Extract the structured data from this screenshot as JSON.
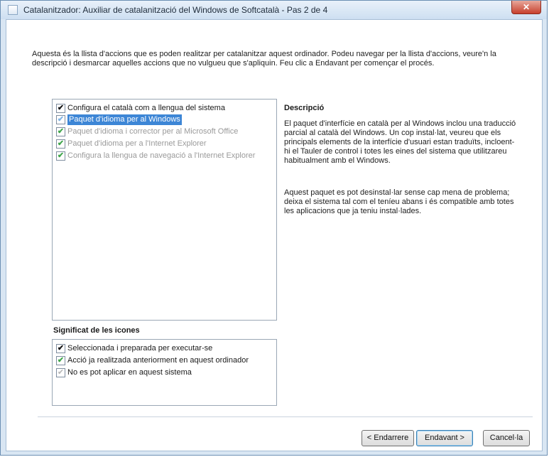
{
  "window": {
    "title": "Catalanitzador: Auxiliar de catalanització del Windows de Softcatalà - Pas 2 de 4",
    "close_glyph": "✕"
  },
  "intro_text": "Aquesta és la llista d'accions que es poden realitzar per catalanitzar aquest ordinador. Podeu navegar per la llista d'accions, veure'n la descripció i desmarcar aquelles accions que no vulgueu que s'apliquin. Feu clic a Endavant per començar el procés.",
  "actions": [
    {
      "label": "Configura el català com a llengua del sistema",
      "check": "✔",
      "state": "selected-black"
    },
    {
      "label": "Paquet d'idioma per al Windows",
      "check": "✔",
      "state": "highlighted"
    },
    {
      "label": "Paquet d'idioma i corrector per al Microsoft Office",
      "check": "✔",
      "state": "done-green"
    },
    {
      "label": "Paquet d'idioma per a l'Internet Explorer",
      "check": "✔",
      "state": "done-green"
    },
    {
      "label": "Configura la llengua de navegació a l'Internet Explorer",
      "check": "✔",
      "state": "done-green"
    }
  ],
  "legend": {
    "title": "Significat de les icones",
    "items": [
      {
        "label": "Seleccionada i preparada per executar-se",
        "check": "✔"
      },
      {
        "label": "Acció ja realitzada anteriorment en aquest ordinador",
        "check": "✔"
      },
      {
        "label": "No es pot aplicar en aquest sistema",
        "check": "✔"
      }
    ]
  },
  "description": {
    "title": "Descripció",
    "p1": "El paquet d'interfície en català per al Windows inclou una traducció parcial al català del Windows. Un cop instal·lat, veureu que els principals elements de la interfície d'usuari estan traduïts, incloent-hi el Tauler de control i totes les eines del sistema que utilitzareu habitualment amb el Windows.",
    "p2": "Aquest paquet es pot desinstal·lar sense cap mena de problema; deixa el sistema tal com el teníeu abans i és compatible amb totes les aplicacions que ja teniu instal·lades."
  },
  "buttons": {
    "back": "< Endarrere",
    "next": "Endavant >",
    "cancel": "Cancel·la"
  },
  "colors": {
    "selection": "#3d86d6",
    "done_check": "#3ea54a",
    "disabled_check": "#b5b5b5"
  }
}
